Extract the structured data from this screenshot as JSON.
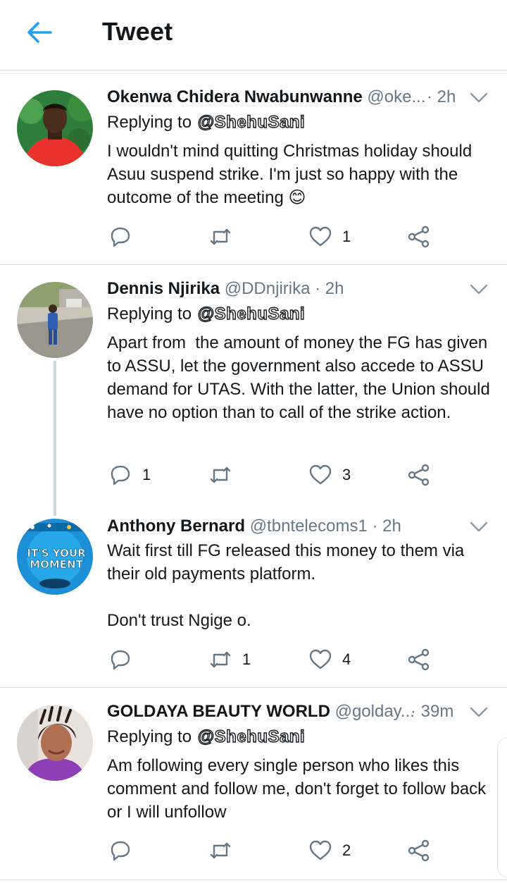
{
  "header": {
    "title": "Tweet",
    "back_icon": "arrow-left-icon",
    "accent": "#1da1f2"
  },
  "tweets": [
    {
      "name": "Okenwa Chidera Nwabunwanne",
      "handle": "@oke...",
      "time": "· 2h",
      "replying_label": "Replying to",
      "replying_to": "@ShehuSani",
      "text": "I wouldn't mind quitting Christmas holiday should Asuu suspend strike. I'm just so happy with the outcome of the meeting 😊",
      "reply_count": "",
      "retweet_count": "",
      "like_count": "1"
    },
    {
      "name": "Dennis Njirika",
      "handle": "@DDnjirika",
      "time": "· 2h",
      "replying_label": "Replying to",
      "replying_to": "@ShehuSani",
      "text": "Apart from  the amount of money the FG has given to ASSU, let the government also accede to ASSU demand for UTAS. With the latter, the Union should have no option than to call of the strike action.",
      "reply_count": "1",
      "retweet_count": "",
      "like_count": "3"
    },
    {
      "name": "Anthony Bernard",
      "handle": "@tbntelecoms1",
      "time": "· 2h",
      "text": "Wait first till FG released this money to them via their old payments platform.\n\nDon't trust Ngige o.",
      "reply_count": "",
      "retweet_count": "1",
      "like_count": "4",
      "avatar_text_1": "IT'S YOUR",
      "avatar_text_2": "MOMENT"
    },
    {
      "name": "GOLDAYA BEAUTY WORLD",
      "handle": "@golday...",
      "time": "· 39m",
      "replying_label": "Replying to",
      "replying_to": "@ShehuSani",
      "text": "Am following every single person who likes this comment and follow me, don't forget to follow back or I will unfollow",
      "reply_count": "",
      "retweet_count": "",
      "like_count": "2"
    }
  ]
}
